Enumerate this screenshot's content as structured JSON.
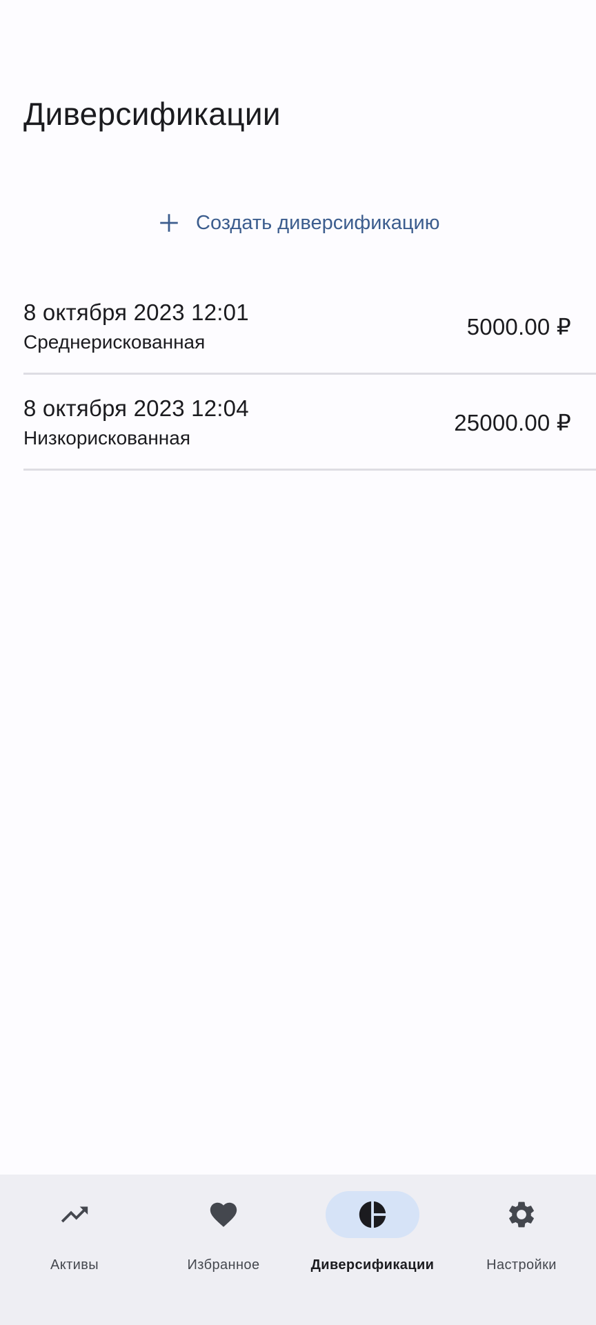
{
  "header": {
    "title": "Диверсификации"
  },
  "actions": {
    "create_label": "Создать диверсификацию",
    "create_icon": "plus-icon"
  },
  "diversifications": [
    {
      "date": "8 октября 2023 12:01",
      "risk": "Среднерискованная",
      "amount": "5000.00 ₽"
    },
    {
      "date": "8 октября 2023 12:04",
      "risk": "Низкорискованная",
      "amount": "25000.00 ₽"
    }
  ],
  "bottom_nav": {
    "selected": "Диверсификации",
    "items": [
      {
        "label": "Активы",
        "icon": "trending-up-icon"
      },
      {
        "label": "Избранное",
        "icon": "heart-icon"
      },
      {
        "label": "Диверсификации",
        "icon": "pie-chart-icon"
      },
      {
        "label": "Настройки",
        "icon": "gear-icon"
      }
    ]
  },
  "colors": {
    "background": "#fdfcff",
    "accent": "#3c5d8e",
    "nav_background": "#eeeef3",
    "nav_active_pill": "#d6e3f7",
    "divider": "#dedde3"
  }
}
